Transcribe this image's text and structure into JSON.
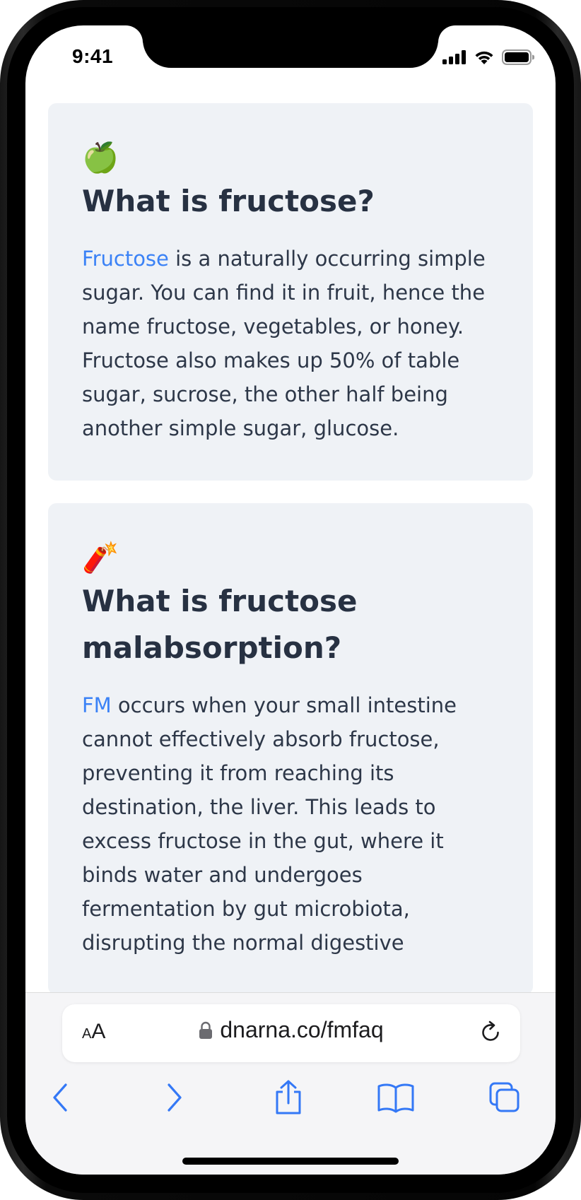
{
  "status_bar": {
    "time": "9:41"
  },
  "cards": [
    {
      "emoji": "🍏",
      "icon_name": "green-apple-icon",
      "title": "What is fructose?",
      "link_text": "Fructose",
      "body": " is a naturally occurring simple sugar. You can find it in fruit, hence the name fructose, vegetables, or honey. Fructose also makes up 50% of table sugar, sucrose, the other half being another simple sugar, glucose."
    },
    {
      "emoji": "🧨",
      "icon_name": "firecracker-icon",
      "title": "What is fructose malabsorption?",
      "link_text": "FM",
      "body": " occurs when your small intestine cannot effectively absorb fructose, preventing it from reaching its destination, the liver. This leads to excess fructose in the gut, where it binds water and undergoes fermentation by gut microbiota, disrupting the normal digestive"
    }
  ],
  "browser": {
    "text_size_label_small": "A",
    "text_size_label_large": "A",
    "url": "dnarna.co/fmfaq"
  },
  "colors": {
    "link": "#3b82f6",
    "card_background": "#eff2f6",
    "heading": "#273142",
    "toolbar_accent": "#3478f6"
  }
}
